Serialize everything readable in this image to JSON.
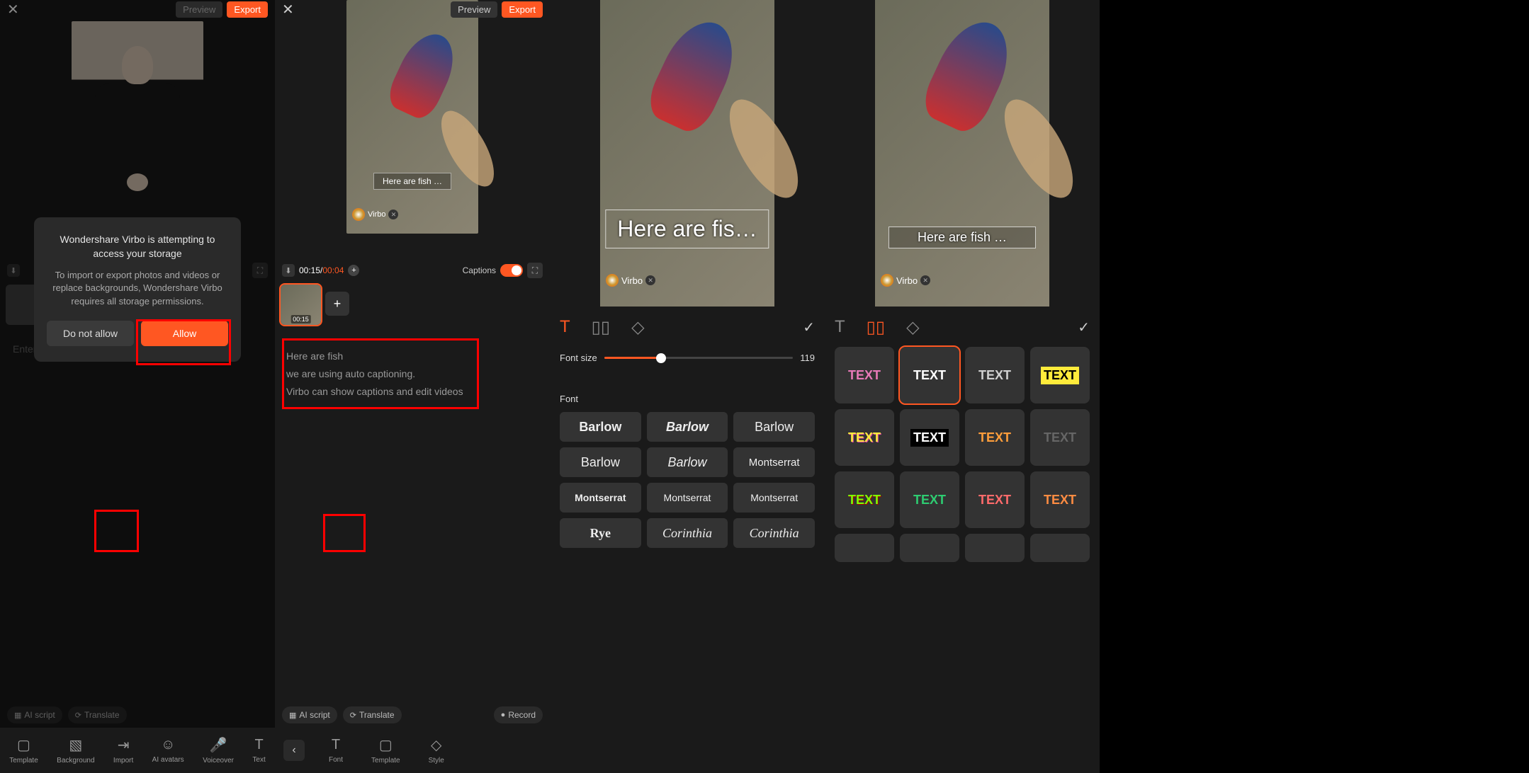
{
  "panel1": {
    "preview_label": "Preview",
    "export_label": "Export",
    "dialog": {
      "title": "Wondershare Virbo is attempting to access your storage",
      "body": "To import or export photos and videos or replace backgrounds, Wondershare Virbo requires all storage permissions.",
      "deny": "Do not allow",
      "allow": "Allow"
    },
    "enter_script_placeholder": "Enter script",
    "chips": {
      "ai": "AI script",
      "translate": "Translate"
    },
    "nav": [
      "Template",
      "Background",
      "Import",
      "AI avatars",
      "Voiceover",
      "Text"
    ]
  },
  "panel2": {
    "preview_label": "Preview",
    "export_label": "Export",
    "caption_text": "Here are fish …",
    "virbo_label": "Virbo",
    "time_current": "00:15",
    "time_total": "00:04",
    "captions_label": "Captions",
    "thumb_time": "00:15",
    "transcript": [
      "Here are fish",
      "we are using auto captioning.",
      "Virbo can show captions and edit videos"
    ],
    "chips": {
      "ai": "AI script",
      "translate": "Translate",
      "record": "Record"
    },
    "nav": [
      "Font",
      "Template",
      "Style"
    ]
  },
  "panel3": {
    "caption_text": "Here are fis…",
    "virbo_label": "Virbo",
    "font_size_label": "Font size",
    "font_size_value": "119",
    "font_label": "Font",
    "fonts": [
      "Barlow",
      "Barlow",
      "Barlow",
      "Barlow",
      "Barlow",
      "Montserrat",
      "Montserrat",
      "Montserrat",
      "Montserrat",
      "Rye",
      "Corinthia",
      "Corinthia"
    ]
  },
  "panel4": {
    "caption_text": "Here are fish …",
    "virbo_label": "Virbo",
    "styles_text": "TEXT"
  }
}
